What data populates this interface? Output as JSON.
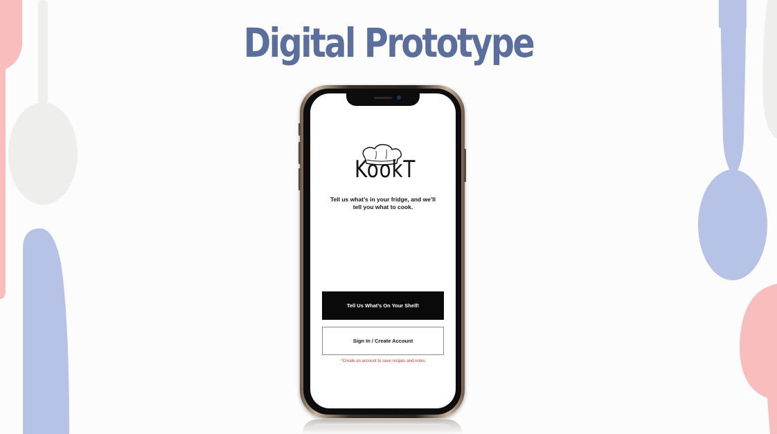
{
  "slide": {
    "title": "Digital Prototype"
  },
  "app": {
    "logo_text": "KookT",
    "logo_icon": "chef-hat-icon",
    "tagline_line1": "Tell us what’s in your fridge, and we’ll",
    "tagline_line2": "tell you what to cook.",
    "primary_button_label": "Tell Us What’s On Your Shelf!",
    "secondary_button_label": "Sign In / Create Account",
    "account_note": "*Create an account to save recipes and notes"
  },
  "decor": {
    "left_icons": [
      "fork-icon",
      "spoon-icon",
      "knife-icon"
    ],
    "right_icons": [
      "spoon-icon",
      "spoon-icon",
      "spoon-icon"
    ]
  },
  "colors": {
    "title": "#5a6f9e",
    "background": "#fcfcfc",
    "pink": "#f9bdbd",
    "blue": "#b6c2e6",
    "grey": "#eeeeec",
    "note_red": "#c0392b",
    "button_black": "#0a0a0a"
  }
}
